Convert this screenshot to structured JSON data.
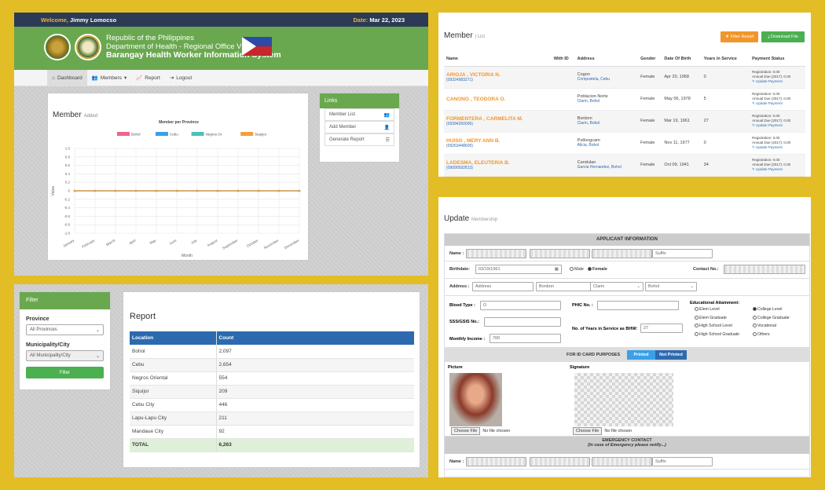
{
  "panel1": {
    "welcome_label": "Welcome,",
    "welcome_name": "Jimmy Lomocso",
    "date_label": "Date:",
    "date_value": "Mar 22, 2023",
    "banner": {
      "line1": "Republic of the Philippines",
      "line2": "Department of Health - Regional Office VII",
      "line3": "Barangay Health Worker Information System"
    },
    "nav": [
      "Dashboard",
      "Members",
      "Report",
      "Logout"
    ],
    "member_title": "Member",
    "member_sub": "Added",
    "links": {
      "title": "Links",
      "items": [
        "Member List",
        "Add Member",
        "Generate Report"
      ]
    }
  },
  "chart_data": {
    "type": "line",
    "title": "Member per Province",
    "xlabel": "Month",
    "ylabel": "Value",
    "categories": [
      "January",
      "February",
      "March",
      "April",
      "May",
      "June",
      "July",
      "August",
      "September",
      "October",
      "November",
      "December"
    ],
    "ylim": [
      -1.0,
      1.0
    ],
    "yticks": [
      "1.0",
      "0.8",
      "0.6",
      "0.4",
      "0.2",
      "0",
      "-0.2",
      "-0.4",
      "-0.6",
      "-0.8",
      "-1.0"
    ],
    "legend_position": "top",
    "series": [
      {
        "name": "Bohol",
        "color": "#f0658a",
        "values": [
          0,
          0,
          0,
          0,
          0,
          0,
          0,
          0,
          0,
          0,
          0,
          0
        ]
      },
      {
        "name": "Cebu",
        "color": "#3aa0e8",
        "values": [
          0,
          0,
          0,
          0,
          0,
          0,
          0,
          0,
          0,
          0,
          0,
          0
        ]
      },
      {
        "name": "Negros Or",
        "color": "#4cc0c0",
        "values": [
          0,
          0,
          0,
          0,
          0,
          0,
          0,
          0,
          0,
          0,
          0,
          0
        ]
      },
      {
        "name": "Siquijor",
        "color": "#f0a040",
        "values": [
          0,
          0,
          0,
          0,
          0,
          0,
          0,
          0,
          0,
          0,
          0,
          0
        ]
      }
    ]
  },
  "panel2": {
    "title": "Member",
    "subtitle": "| List",
    "filter_btn": "Filter Result",
    "download_btn": "Download File",
    "headers": [
      "Name",
      "With ID",
      "Address",
      "Gender",
      "Date Of Birth",
      "Years in Service",
      "Payment Status"
    ],
    "rows": [
      {
        "name": "ARIOJA , VICTORIA N.",
        "phone": "(09324983271)",
        "addr1": "Cogon",
        "addr2": "Compostela, Cebu",
        "gender": "Female",
        "dob": "Apr 20, 1968",
        "years": "0"
      },
      {
        "name": "CANONO , TEODORA O.",
        "phone": "",
        "addr1": "Poblacion Norte",
        "addr2": "Clarin, Bohol",
        "gender": "Female",
        "dob": "May 06, 1978",
        "years": "5"
      },
      {
        "name": "FORMENTERA , CARMELITA M.",
        "phone": "(09394260006)",
        "addr1": "Bonbon",
        "addr2": "Clarin, Bohol",
        "gender": "Female",
        "dob": "Mar 19, 1961",
        "years": "27"
      },
      {
        "name": "HUISO , MERY ANN B.",
        "phone": "(09263448600)",
        "addr1": "Putlongcam",
        "addr2": "Alicia, Bohol",
        "gender": "Female",
        "dob": "Nov 11, 1977",
        "years": "0"
      },
      {
        "name": "LADESMA, ELEUTERIA B.",
        "phone": "(09090592813)",
        "addr1": "Candulao",
        "addr2": "Garcia Hernandez, Bohol",
        "gender": "Female",
        "dob": "Oct 09, 1941",
        "years": "34"
      }
    ],
    "pay_reg": "Registration: 0.00",
    "pay_annual": "Annual Due (2017): 0.00",
    "pay_link": "Update Payment"
  },
  "panel3": {
    "filter_title": "Filter",
    "province_label": "Province",
    "province_value": "All Provinces",
    "city_label": "Municipality/City",
    "city_value": "All Municipality/City",
    "filter_btn": "Filter",
    "report_title": "Report",
    "headers": [
      "Location",
      "Count"
    ],
    "rows": [
      [
        "Bohol",
        "2,097"
      ],
      [
        "Cebu",
        "2,654"
      ],
      [
        "Negros Oriental",
        "554"
      ],
      [
        "Siquijor",
        "209"
      ],
      [
        "Cebu City",
        "446"
      ],
      [
        "Lapu-Lapu City",
        "211"
      ],
      [
        "Mandaue City",
        "92"
      ]
    ],
    "total": [
      "TOTAL",
      "6,263"
    ]
  },
  "panel4": {
    "title": "Update",
    "subtitle": "Membership",
    "sec_applicant": "APPLICANT INFORMATION",
    "name_label": "Name :",
    "suffix_ph": "Suffix",
    "birthdate_label": "Birthdate:",
    "birthdate_value": "03/19/1961",
    "male": "Male",
    "female": "Female",
    "contact_label": "Contact No.:",
    "address_label": "Address :",
    "address_ph": "Address",
    "barangay": "Bonbon",
    "municipality": "Clarin",
    "province": "Bohol",
    "blood_label": "Blood Type :",
    "blood_value": "O",
    "phic_label": "PHIC No. :",
    "edu_label": "Educational Attainment:",
    "edu_left": [
      "Elem Level",
      "Elem Graduate",
      "High School Level",
      "High School Graduate"
    ],
    "edu_right": [
      "College Level",
      "College Graduate",
      "Vocational",
      "Others"
    ],
    "sss_label": "SSS/GSIS No.:",
    "years_label": "No. of Years in Service as BHW:",
    "years_value": "27",
    "income_label": "Monthly Income :",
    "income_value": "700",
    "idcard_label": "FOR ID CARD PURPOSES",
    "printed": "Printed",
    "not_printed": "Not Printed",
    "picture_label": "Picture",
    "signature_label": "Signature",
    "choose_file": "Choose File",
    "no_file": "No file chosen",
    "sec_emergency": "EMERGENCY CONTACT",
    "emergency_sub": "(In case of Emergency please notify...)"
  }
}
